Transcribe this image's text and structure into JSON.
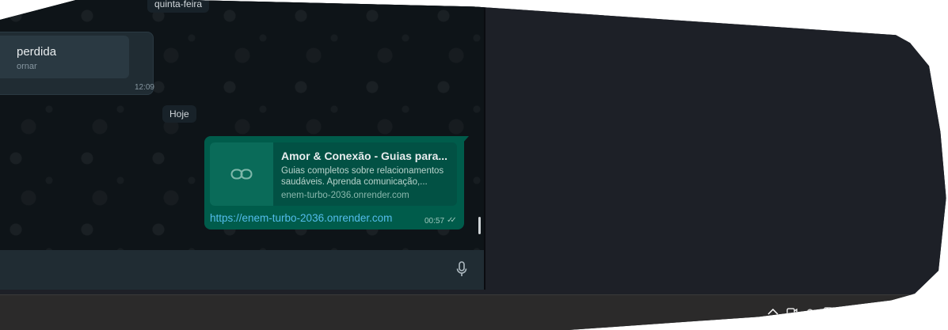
{
  "chat": {
    "date_separators": [
      "quinta-feira",
      "Hoje"
    ],
    "missed_call": {
      "title": "perdida",
      "subtitle": "ornar",
      "time": "12:09"
    },
    "outgoing_message": {
      "preview_title": "Amor & Conexão - Guias para...",
      "preview_description": "Guias completos sobre relacionamentos saudáveis. Aprenda comunicação,...",
      "preview_domain": "enem-turbo-2036.onrender.com",
      "link_text": "https://enem-turbo-2036.onrender.com",
      "time": "00:57",
      "ticks": "✓✓"
    }
  },
  "composer": {
    "mic_icon": "microphone-icon"
  },
  "taskbar": {
    "tray_icons": [
      "chevron-up-icon",
      "meet-icon",
      "cloud-icon",
      "keyboard-icon"
    ]
  },
  "colors": {
    "outgoing_bubble": "#005c4b",
    "incoming_bubble": "#202c33",
    "link": "#53bdeb",
    "chat_background": "#0e1418"
  }
}
